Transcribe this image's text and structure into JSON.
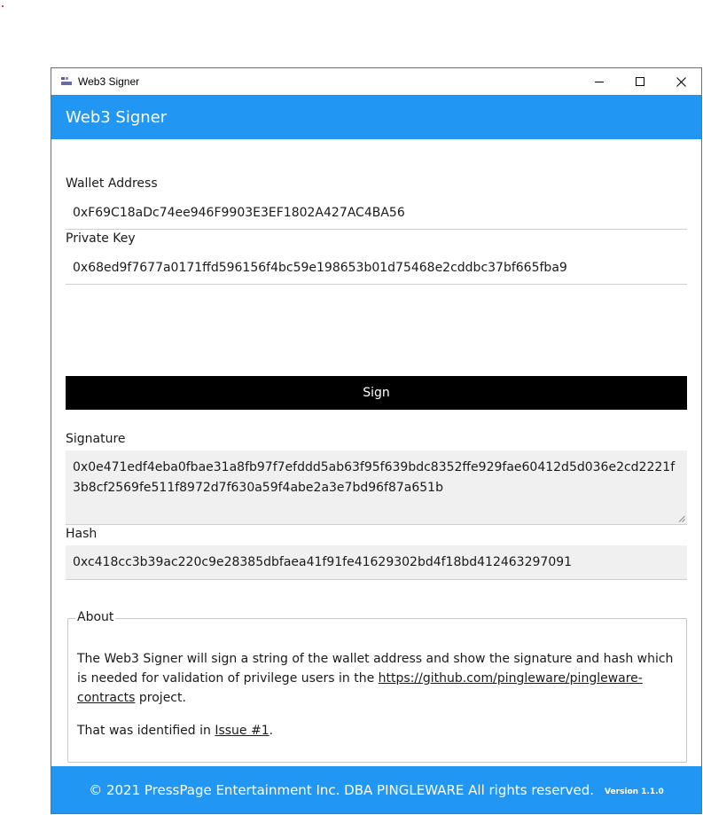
{
  "window": {
    "title": "Web3 Signer",
    "controls": [
      "minimize-icon",
      "maximize-icon",
      "close-icon"
    ]
  },
  "header": {
    "title": "Web3 Signer",
    "color": "#2196f3"
  },
  "form": {
    "wallet_label": "Wallet Address",
    "wallet_value": "0xF69C18aDc74ee946F9903E3EF1802A427AC4BA56",
    "private_key_label": "Private Key",
    "private_key_value": "0x68ed9f7677a0171ffd596156f4bc59e198653b01d75468e2cddbc37bf665fba9",
    "sign_label": "Sign",
    "signature_label": "Signature",
    "signature_value": "0x0e471edf4eba0fbae31a8fb97f7efddd5ab63f95f639bdc8352ffe929fae60412d5d036e2cd2221f3b8cf2569fe511f8972d7f630a59f4abe2a3e7bd96f87a651b",
    "hash_label": "Hash",
    "hash_value": "0xc418cc3b39ac220c9e28385dbfaea41f91fe41629302bd4f18bd412463297091"
  },
  "about": {
    "legend": "About",
    "text1_pre": "The Web3 Signer will sign a string of the wallet address and show the signature and hash which is needed for validation of privilege users in the ",
    "text1_link": "https://github.com/pingleware/pingleware-contracts",
    "text1_post": " project.",
    "text2_pre": "That was identified in ",
    "text2_link": "Issue #1",
    "text2_post": "."
  },
  "footer": {
    "copyright": "© 2021 PressPage Entertainment Inc. DBA PINGLEWARE  All rights reserved.",
    "version": "Version 1.1.0"
  }
}
